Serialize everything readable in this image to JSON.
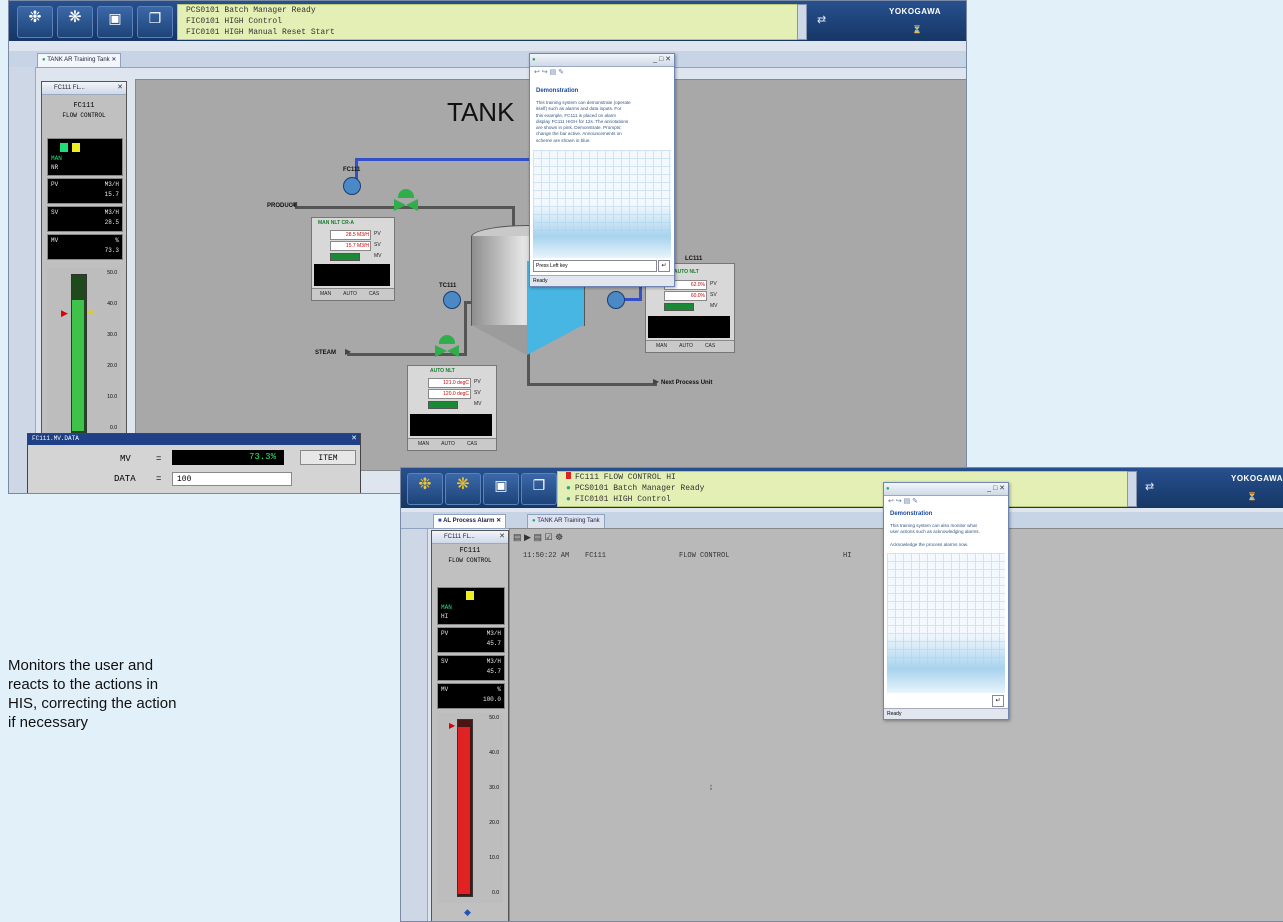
{
  "caption": {
    "lines": [
      "Monitors the user and",
      "reacts to the actions in",
      "HIS, correcting the action",
      "if necessary"
    ]
  },
  "screen1": {
    "messages": [
      "PCS0101  Batch Manager Ready",
      "FIC0101  HIGH     Control",
      "FIC0101  HIGH     Manual Reset Start"
    ],
    "logo": "YOKOGAWA",
    "tab": "TANK AR Training Tank",
    "faceplate": {
      "title": "FC111 FL...",
      "tag": "FC111",
      "desc": "FLOW CONTROL",
      "status1": "MAN",
      "status2": "NR",
      "pv_label": "PV",
      "pv_unit": "M3/H",
      "pv_value": "15.7",
      "sv_label": "SV",
      "sv_unit": "M3/H",
      "sv_value": "28.5",
      "mv_label": "MV",
      "mv_unit": "%",
      "mv_value": "73.3",
      "scale": [
        "50.0",
        "40.0",
        "30.0",
        "20.0",
        "10.0",
        "0.0"
      ]
    },
    "graphic": {
      "title": "TANK",
      "tags": [
        "FC111",
        "TC111",
        "LC111"
      ],
      "product_label": "PRODUCT",
      "steam_label": "STEAM",
      "next_label": "Next Process Unit"
    },
    "fp1": {
      "title": "MAN  NLT  CR-A",
      "row1": "28.5 M3/H",
      "row1u": "PV",
      "row2": "15.7 M3/H",
      "row2u": "SV",
      "row3u": "MV",
      "foot": [
        "MAN",
        "AUTO",
        "CAS"
      ]
    },
    "fp2": {
      "title": "AUTO  NLT",
      "row1": "121.0 degC",
      "row1u": "PV",
      "row2": "120.0 degC",
      "row2u": "SV",
      "row3u": "MV",
      "foot": [
        "MAN",
        "AUTO",
        "CAS"
      ]
    },
    "fp3": {
      "title": "LC111",
      "status": "AUTO  NLT",
      "row1": "62.0%",
      "row1u": "PV",
      "row2": "60.0%",
      "row2u": "SV",
      "row3u": "MV",
      "foot": [
        "MAN",
        "AUTO",
        "CAS"
      ]
    },
    "guide": {
      "title": "Demonstration",
      "text": [
        "This training system can demonstrate (operate",
        "itself) such as alarms and data inputs. For",
        "this example, FC111 is placed on alarm",
        "display FC111 HIGH for 12s. The annotations",
        "are shown in pink. Demonstrate. Prompts:",
        "change the bar active. Announcements on",
        "scheme are shown in blue."
      ],
      "footer": "Press Left key",
      "status": "Ready"
    },
    "dataentry": {
      "title": "FC111.MV.DATA",
      "mv_label": "MV",
      "mv_value": "73.3%",
      "item_label": "ITEM",
      "data_label": "DATA",
      "data_value": "100"
    }
  },
  "screen2": {
    "messages": [
      "FC111         FLOW CONTROL          HI",
      "PCS0101  Batch Manager Ready",
      "FIC0101  HIGH     Control"
    ],
    "logo": "YOKOGAWA",
    "tabs": [
      "AL Process Alarm",
      "TANK AR Training Tank"
    ],
    "faceplate": {
      "title": "FC111 FL...",
      "tag": "FC111",
      "desc": "FLOW CONTROL",
      "status1": "MAN",
      "status2": "HI",
      "pv_label": "PV",
      "pv_unit": "M3/H",
      "pv_value": "45.7",
      "sv_label": "SV",
      "sv_unit": "M3/H",
      "sv_value": "45.7",
      "mv_label": "MV",
      "mv_unit": "%",
      "mv_value": "100.0",
      "scale": [
        "50.0",
        "40.0",
        "30.0",
        "20.0",
        "10.0",
        "0.0"
      ]
    },
    "alarm_line": {
      "time": "11:50:22 AM",
      "tag": "FC111",
      "desc": "FLOW CONTROL",
      "status": "HI"
    },
    "guide": {
      "title": "Demonstration",
      "text": [
        "This training system can also monitor what",
        "user actions such as acknowledging alarms.",
        "",
        "Acknowledge the process alarms now."
      ],
      "status": "Ready"
    }
  }
}
